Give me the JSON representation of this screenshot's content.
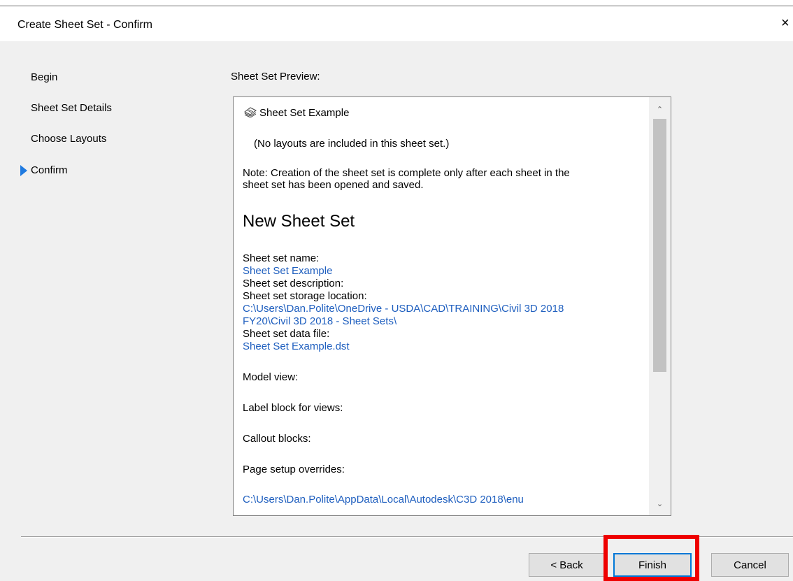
{
  "window": {
    "title": "Create Sheet Set - Confirm",
    "close_glyph": "×"
  },
  "nav": {
    "items": [
      {
        "label": "Begin",
        "active": false
      },
      {
        "label": "Sheet Set Details",
        "active": false
      },
      {
        "label": "Choose Layouts",
        "active": false
      },
      {
        "label": "Confirm",
        "active": true
      }
    ],
    "active_marker_color": "#1f7ae0"
  },
  "preview": {
    "label": "Sheet Set Preview:",
    "root_item": "Sheet Set Example",
    "no_layouts_note": "(No layouts are included in this sheet set.)",
    "note_line1": "Note: Creation of the sheet set is complete only after each sheet in the",
    "note_line2": "sheet set has been opened and saved.",
    "heading": "New Sheet Set",
    "name_label": "Sheet set name:",
    "name_value": "Sheet Set Example",
    "description_label": "Sheet set description:",
    "storage_label": "Sheet set storage location:",
    "storage_value_line1": "C:\\Users\\Dan.Polite\\OneDrive - USDA\\CAD\\TRAINING\\Civil 3D 2018",
    "storage_value_line2": "FY20\\Civil 3D 2018 - Sheet Sets\\",
    "data_file_label": "Sheet set data file:",
    "data_file_value": "Sheet Set Example.dst",
    "model_view_label": "Model view:",
    "label_block_label": "Label block for views:",
    "callout_label": "Callout blocks:",
    "page_setup_label": "Page setup overrides:",
    "page_setup_value": "C:\\Users\\Dan.Polite\\AppData\\Local\\Autodesk\\C3D 2018\\enu",
    "link_color": "#1f5fbf",
    "scroll_up_glyph": "⌃",
    "scroll_down_glyph": "⌄"
  },
  "buttons": {
    "back": "< Back",
    "finish": "Finish",
    "cancel": "Cancel"
  },
  "annotation": {
    "highlight_color": "#ee0000"
  }
}
